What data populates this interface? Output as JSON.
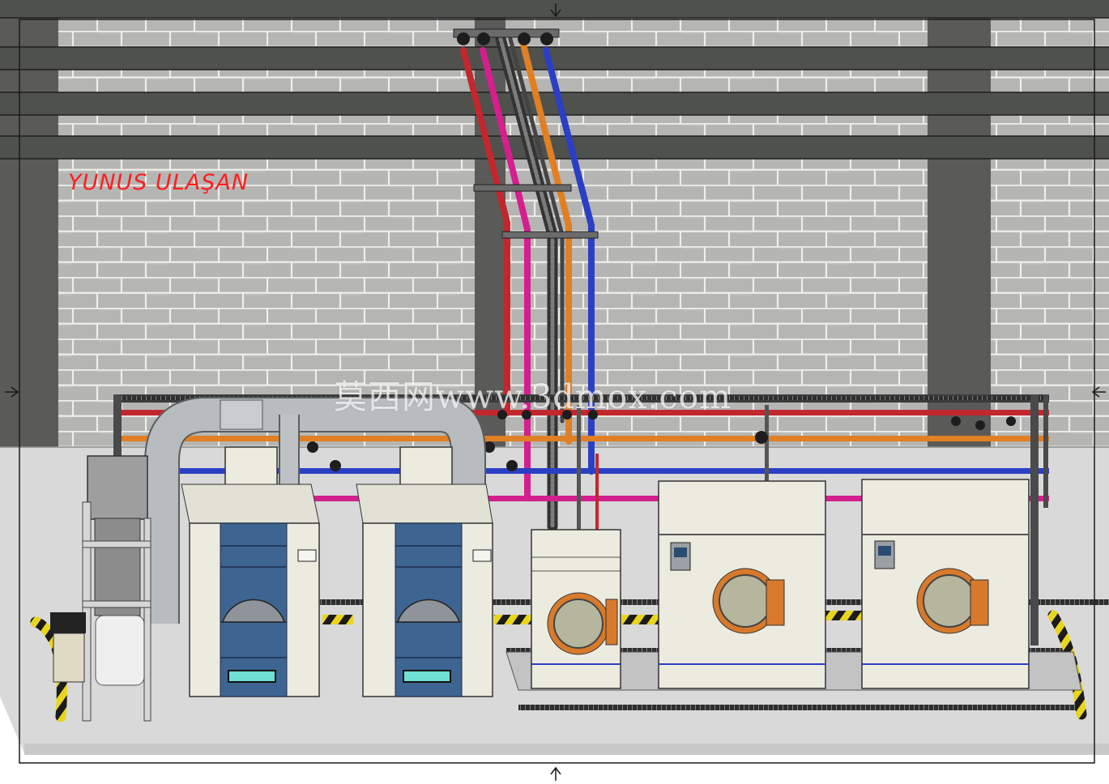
{
  "drawing": {
    "author_label": "YUNUS ULAŞAN",
    "watermark": "莫西网www.3dmox.com"
  },
  "colors": {
    "wall": "#b5b5b3",
    "mortar": "#ecece8",
    "column": "#5a5a58",
    "beam": "#4e514c",
    "floor": "#d9d9d9",
    "hot_water_pipe": "#c2272d",
    "steam_pipe": "#d41f8e",
    "warm_water_pipe": "#e07f24",
    "cold_water_pipe": "#2b3fc4",
    "duct": "#b8bcbf",
    "machine_body": "#ecebe0",
    "dryer_front": "#3e6491",
    "door_ring": "#d77a2c",
    "hazard_yellow": "#e9d51c",
    "label_red": "#ff1e1e"
  },
  "equipment": [
    {
      "id": "dust-filter",
      "type": "lint filter unit"
    },
    {
      "id": "dryer-1",
      "type": "tumble dryer"
    },
    {
      "id": "dryer-2",
      "type": "tumble dryer"
    },
    {
      "id": "washer-small",
      "type": "washer extractor"
    },
    {
      "id": "washer-medium",
      "type": "washer extractor"
    },
    {
      "id": "washer-large",
      "type": "washer extractor"
    }
  ],
  "pipes": [
    "hot_water_pipe",
    "steam_pipe",
    "warm_water_pipe",
    "cold_water_pipe"
  ],
  "icons": [
    "valve-icon",
    "control-panel-icon",
    "section-arrow-icon"
  ]
}
